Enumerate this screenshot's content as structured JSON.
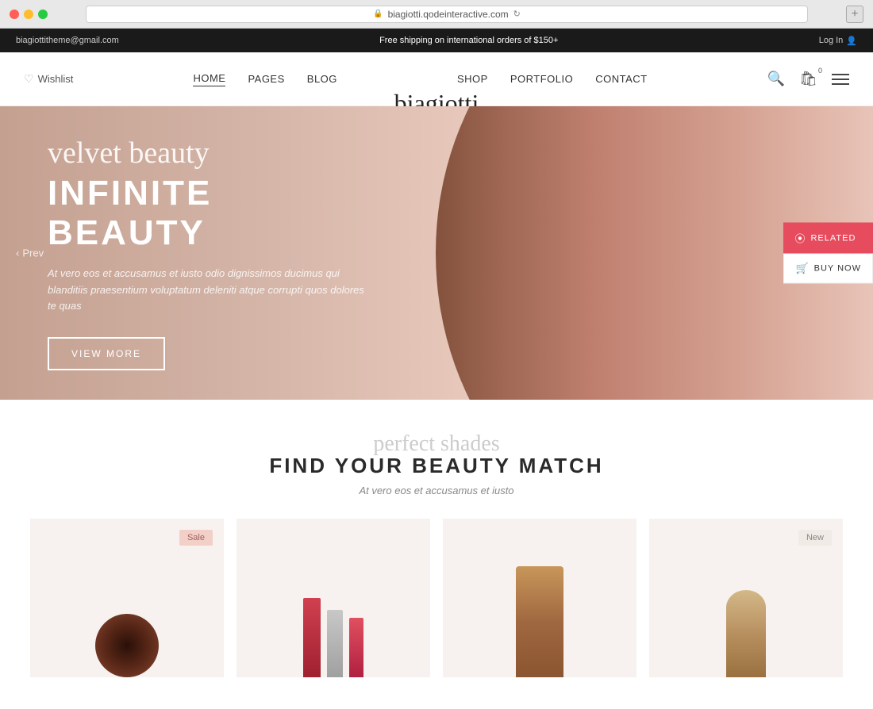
{
  "browser": {
    "address": "biagiotti.qodeinteractive.com",
    "new_tab_label": "+"
  },
  "topbar": {
    "email": "biagiottitheme@gmail.com",
    "promo": "Free shipping on international orders of $150+",
    "login": "Log In"
  },
  "nav": {
    "wishlist": "Wishlist",
    "links": [
      {
        "label": "HOME",
        "active": true
      },
      {
        "label": "PAGES",
        "active": false
      },
      {
        "label": "BLOG",
        "active": false
      },
      {
        "label": "SHOP",
        "active": false
      },
      {
        "label": "PORTFOLIO",
        "active": false
      },
      {
        "label": "CONTACT",
        "active": false
      }
    ],
    "logo": "biagiotti",
    "cart_count": "0"
  },
  "hero": {
    "script_text": "velvet beauty",
    "title": "INFINITE BEAUTY",
    "description": "At vero eos et accusamus et iusto odio dignissimos ducimus qui blanditiis praesentium voluptatum deleniti atque corrupti quos dolores te quas",
    "button_label": "VIEW MORE",
    "prev_label": "Prev",
    "related_label": "RELATED",
    "buy_label": "BUY NOW"
  },
  "products": {
    "script_text": "perfect shades",
    "title": "FIND YOUR BEAUTY MATCH",
    "subtitle": "At vero eos et accusamus et iusto",
    "items": [
      {
        "badge": "Sale"
      },
      {
        "badge": null
      },
      {
        "badge": null
      },
      {
        "badge": "New"
      }
    ]
  }
}
